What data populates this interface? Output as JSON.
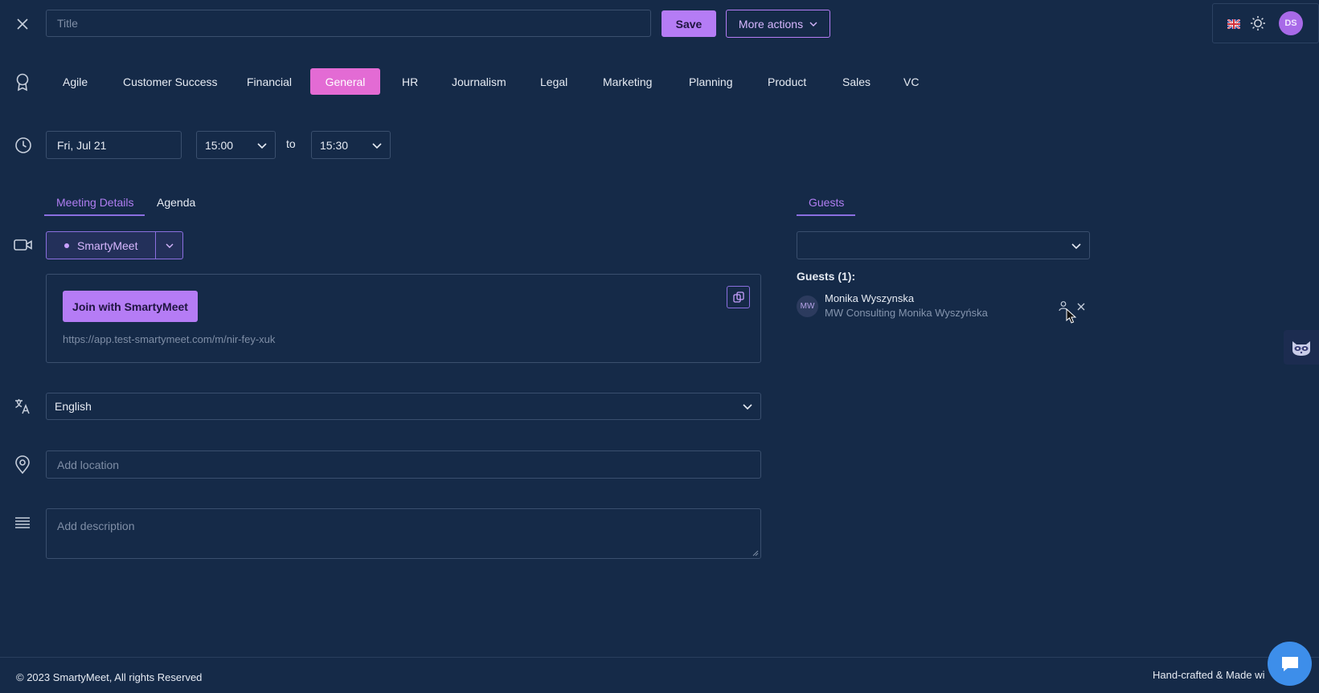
{
  "header": {
    "title_placeholder": "Title",
    "save_label": "Save",
    "more_actions_label": "More actions",
    "avatar_initials": "DS"
  },
  "categories": [
    {
      "label": "Agile",
      "active": false
    },
    {
      "label": "Customer Success",
      "active": false
    },
    {
      "label": "Financial",
      "active": false
    },
    {
      "label": "General",
      "active": true
    },
    {
      "label": "HR",
      "active": false
    },
    {
      "label": "Journalism",
      "active": false
    },
    {
      "label": "Legal",
      "active": false
    },
    {
      "label": "Marketing",
      "active": false
    },
    {
      "label": "Planning",
      "active": false
    },
    {
      "label": "Product",
      "active": false
    },
    {
      "label": "Sales",
      "active": false
    },
    {
      "label": "VC",
      "active": false
    }
  ],
  "datetime": {
    "date": "Fri, Jul 21",
    "start": "15:00",
    "to_label": "to",
    "end": "15:30"
  },
  "tabs": {
    "meeting_details": "Meeting Details",
    "agenda": "Agenda",
    "guests": "Guests"
  },
  "meeting": {
    "provider": "SmartyMeet",
    "join_label": "Join with SmartyMeet",
    "link": "https://app.test-smartymeet.com/m/nir-fey-xuk"
  },
  "language": {
    "value": "English"
  },
  "location": {
    "placeholder": "Add location"
  },
  "description": {
    "placeholder": "Add description"
  },
  "guests": {
    "heading": "Guests (1):",
    "list": [
      {
        "initials": "MW",
        "name": "Monika Wyszynska",
        "company": "MW Consulting Monika Wyszyńska"
      }
    ]
  },
  "footer": {
    "copyright": "© 2023 SmartyMeet, All rights Reserved",
    "made_with": "Hand-crafted & Made wi"
  },
  "colors": {
    "background": "#152a48",
    "accent": "#b57cf5",
    "active_category": "#e36bd4"
  }
}
